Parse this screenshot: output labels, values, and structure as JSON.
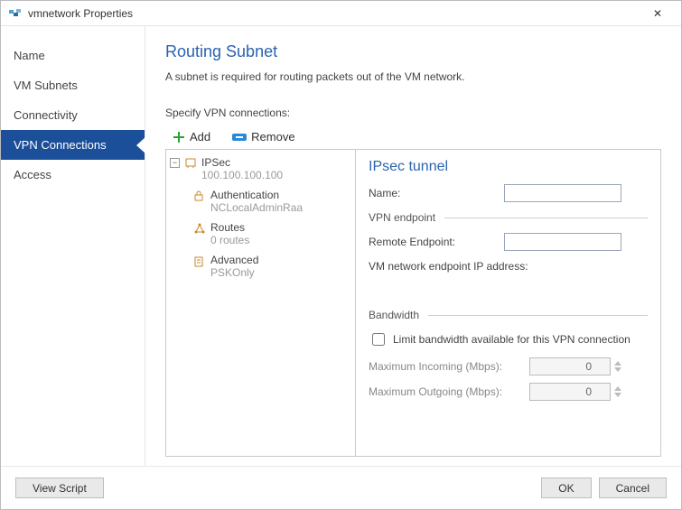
{
  "window": {
    "title": "vmnetwork Properties",
    "close_char": "✕"
  },
  "sidebar": {
    "items": [
      {
        "label": "Name"
      },
      {
        "label": "VM Subnets"
      },
      {
        "label": "Connectivity"
      },
      {
        "label": "VPN Connections",
        "selected": true
      },
      {
        "label": "Access"
      }
    ]
  },
  "page": {
    "heading": "Routing Subnet",
    "subtitle": "A subnet is required for routing packets out of the VM network.",
    "specify_label": "Specify VPN connections:",
    "toolbar": {
      "add": "Add",
      "remove": "Remove"
    }
  },
  "tree": {
    "root": {
      "label": "IPSec",
      "sub": "100.100.100.100"
    },
    "children": [
      {
        "label": "Authentication",
        "sub": "NCLocalAdminRaa"
      },
      {
        "label": "Routes",
        "sub": "0 routes"
      },
      {
        "label": "Advanced",
        "sub": "PSKOnly"
      }
    ]
  },
  "detail": {
    "heading": "IPsec tunnel",
    "name_label": "Name:",
    "name_value": "",
    "vpn_endpoint_group": "VPN endpoint",
    "remote_label": "Remote Endpoint:",
    "remote_value": "",
    "vm_ep_label": "VM network endpoint IP address:",
    "bandwidth_group": "Bandwidth",
    "limit_label": "Limit bandwidth available for this VPN connection",
    "limit_checked": false,
    "max_in_label": "Maximum Incoming (Mbps):",
    "max_in_value": "0",
    "max_out_label": "Maximum Outgoing (Mbps):",
    "max_out_value": "0"
  },
  "footer": {
    "view_script": "View Script",
    "ok": "OK",
    "cancel": "Cancel"
  }
}
